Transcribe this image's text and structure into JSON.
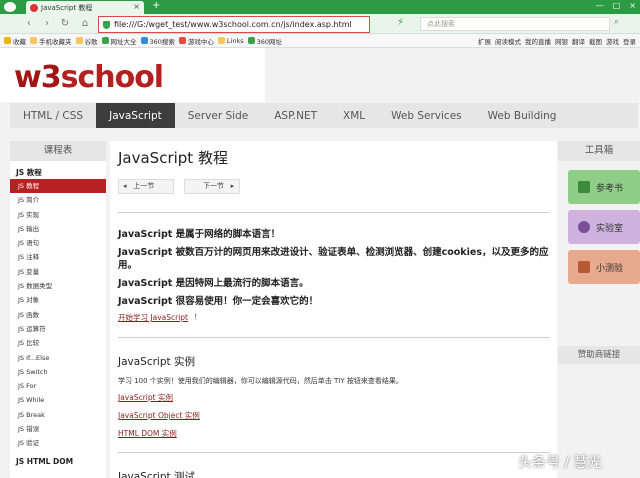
{
  "browser": {
    "tab_title": "JavaScript 教程",
    "url": "file:///G:/wget_test/www.w3school.com.cn/js/index.asp.html",
    "search_placeholder": "点此搜索",
    "bookmarks": [
      "收藏",
      "手机收藏夹",
      "谷歌",
      "网址大全",
      "360搜索",
      "游戏中心",
      "Links",
      "360网址"
    ],
    "bookmarks_right": [
      "扩展",
      "阅读模式",
      "我的直播",
      "网银",
      "翻译",
      "截图",
      "游戏",
      "登录"
    ]
  },
  "site": {
    "brand_w3": "w3",
    "brand_school": "school",
    "nav": [
      "HTML / CSS",
      "JavaScript",
      "Server Side",
      "ASP.NET",
      "XML",
      "Web Services",
      "Web Building"
    ],
    "active_nav": "JavaScript"
  },
  "leftnav": {
    "header": "课程表",
    "group1": "JS 教程",
    "items": [
      "JS 教程",
      "JS 简介",
      "JS 实现",
      "JS 输出",
      "JS 语句",
      "JS 注释",
      "JS 变量",
      "JS 数据类型",
      "JS 对象",
      "JS 函数",
      "JS 运算符",
      "JS 比较",
      "JS If...Else",
      "JS Switch",
      "JS For",
      "JS While",
      "JS Break",
      "JS 错误",
      "JS 验证"
    ],
    "group2": "JS HTML DOM"
  },
  "main": {
    "title": "JavaScript 教程",
    "prev": "上一节",
    "next": "下一节",
    "intro": [
      "JavaScript 是属于网络的脚本语言！",
      "JavaScript 被数百万计的网页用来改进设计、验证表单、检测浏览器、创建cookies，以及更多的应",
      "用。",
      "JavaScript 是因特网上最流行的脚本语言。",
      "JavaScript 很容易使用！你一定会喜欢它的！"
    ],
    "start_link": "开始学习 JavaScript",
    "start_suffix": "！",
    "examples_title": "JavaScript 实例",
    "examples_desc": "学习 100 个实例！使用我们的编辑器，你可以编辑源代码，然后单击 TIY 按钮来查看结果。",
    "example_links": [
      "JavaScript 实例",
      "JavaScript Object 实例",
      "HTML DOM 实例"
    ],
    "test_title": "JavaScript 测试"
  },
  "tools": {
    "header": "工具箱",
    "buttons": [
      {
        "label": "参考书",
        "color": "#8fce86",
        "icon_color": "#3d8a3a"
      },
      {
        "label": "实验室",
        "color": "#cfb2de",
        "icon_color": "#7b4e9a"
      },
      {
        "label": "小测验",
        "color": "#e9a98c",
        "icon_color": "#b85a35"
      }
    ],
    "sponsor": "赞助商链接"
  },
  "watermark": "头条号 / 慧光"
}
